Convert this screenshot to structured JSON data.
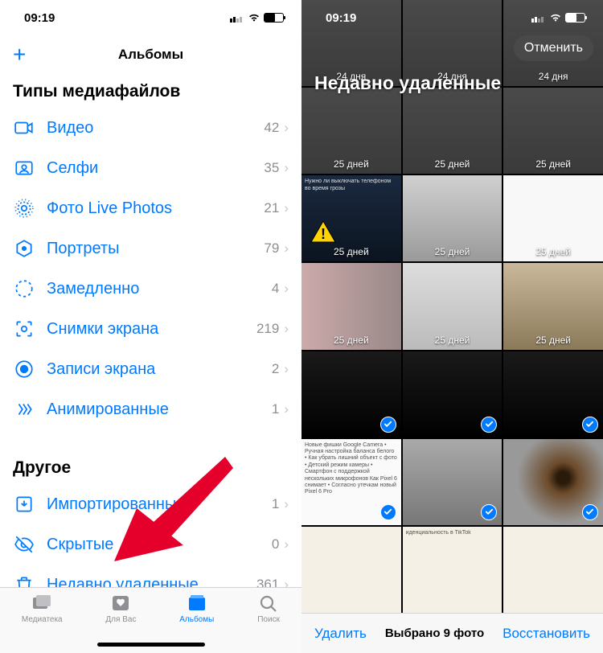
{
  "left": {
    "status_time": "09:19",
    "nav_title": "Альбомы",
    "section1": "Типы медиафайлов",
    "section2": "Другое",
    "media_types": [
      {
        "icon": "video",
        "label": "Видео",
        "count": "42"
      },
      {
        "icon": "selfie",
        "label": "Селфи",
        "count": "35"
      },
      {
        "icon": "live",
        "label": "Фото Live Photos",
        "count": "21"
      },
      {
        "icon": "portrait",
        "label": "Портреты",
        "count": "79"
      },
      {
        "icon": "slomo",
        "label": "Замедленно",
        "count": "4"
      },
      {
        "icon": "screenshot",
        "label": "Снимки экрана",
        "count": "219"
      },
      {
        "icon": "screenrec",
        "label": "Записи экрана",
        "count": "2"
      },
      {
        "icon": "animated",
        "label": "Анимированные",
        "count": "1"
      }
    ],
    "other": [
      {
        "icon": "import",
        "label": "Импортированные",
        "count": "1"
      },
      {
        "icon": "hidden",
        "label": "Скрытые",
        "count": "0"
      },
      {
        "icon": "trash",
        "label": "Недавно удаленные",
        "count": "361"
      }
    ],
    "tabs": [
      {
        "label": "Медиатека",
        "active": false
      },
      {
        "label": "Для Вас",
        "active": false
      },
      {
        "label": "Альбомы",
        "active": true
      },
      {
        "label": "Поиск",
        "active": false
      }
    ]
  },
  "right": {
    "status_time": "09:19",
    "cancel": "Отменить",
    "title": "Недавно удаленные",
    "thumbs": [
      {
        "bg": "bg-text",
        "days": "24 дня",
        "sel": false,
        "cap": ""
      },
      {
        "bg": "bg-text",
        "days": "24 дня",
        "sel": false,
        "cap": ""
      },
      {
        "bg": "bg-text",
        "days": "24 дня",
        "sel": false,
        "cap": ""
      },
      {
        "bg": "bg-text",
        "days": "25 дней",
        "sel": false,
        "cap": ""
      },
      {
        "bg": "bg-text",
        "days": "25 дней",
        "sel": false,
        "cap": ""
      },
      {
        "bg": "bg-text",
        "days": "25 дней",
        "sel": false,
        "cap": ""
      },
      {
        "bg": "bg-warn",
        "days": "25 дней",
        "sel": false,
        "cap": "Нужно ли выключать телефоном во время грозы"
      },
      {
        "bg": "bg-room",
        "days": "25 дней",
        "sel": false,
        "cap": ""
      },
      {
        "bg": "bg-chat",
        "days": "25 дней",
        "sel": false,
        "cap": ""
      },
      {
        "bg": "bg-faces",
        "days": "25 дней",
        "sel": false,
        "cap": ""
      },
      {
        "bg": "bg-bag",
        "days": "25 дней",
        "sel": false,
        "cap": ""
      },
      {
        "bg": "bg-group",
        "days": "25 дней",
        "sel": false,
        "cap": ""
      },
      {
        "bg": "bg-phone",
        "days": "",
        "sel": true,
        "cap": ""
      },
      {
        "bg": "bg-phone",
        "days": "",
        "sel": true,
        "cap": ""
      },
      {
        "bg": "bg-phone",
        "days": "",
        "sel": true,
        "cap": ""
      },
      {
        "bg": "bg-list",
        "days": "",
        "sel": true,
        "cap": "Новые фишки Google Camera • Ручная настройка баланса белого • Как убрать лишний объект с фото • Детский режим камеры • Смартфон с поддержкой нескольких микрофонов  Как Pixel 6 снимает • Согласно утечкам новый Pixel 6 Pro"
      },
      {
        "bg": "bg-dog",
        "days": "",
        "sel": true,
        "cap": ""
      },
      {
        "bg": "bg-eye",
        "days": "",
        "sel": true,
        "cap": ""
      },
      {
        "bg": "bg-doc",
        "days": "",
        "sel": false,
        "cap": ""
      },
      {
        "bg": "bg-doc",
        "days": "",
        "sel": false,
        "cap": "иденциальность в TikTok"
      },
      {
        "bg": "bg-doc",
        "days": "",
        "sel": false,
        "cap": ""
      }
    ],
    "delete": "Удалить",
    "selected": "Выбрано 9 фото",
    "recover": "Восстановить"
  }
}
